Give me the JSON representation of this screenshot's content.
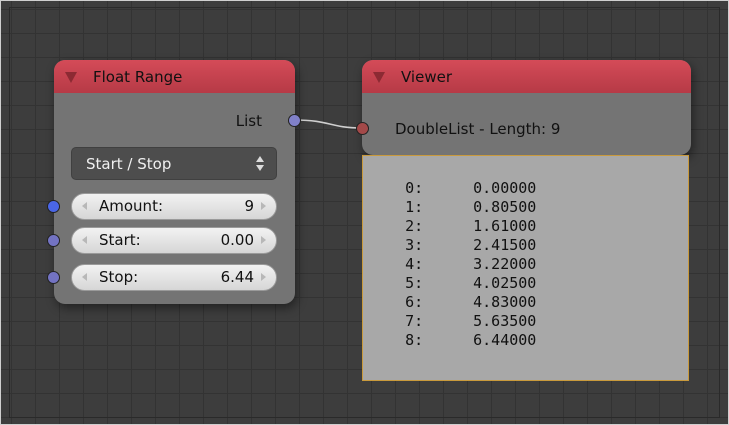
{
  "float_range_node": {
    "title": "Float Range",
    "output_label": "List",
    "mode_dropdown": {
      "selected": "Start / Stop"
    },
    "fields": [
      {
        "label": "Amount:",
        "value": "9",
        "socket_color": "#4a66e6"
      },
      {
        "label": "Start:",
        "value": "0.00",
        "socket_color": "#7373c2"
      },
      {
        "label": "Stop:",
        "value": "6.44",
        "socket_color": "#7373c2"
      }
    ],
    "output_socket_color": "#8080c8"
  },
  "viewer_node": {
    "title": "Viewer",
    "info_label": "DoubleList - Length: 9",
    "input_socket_color": "#a34949"
  },
  "text_panel": {
    "rows": [
      {
        "index": "0:",
        "value": "0.00000"
      },
      {
        "index": "1:",
        "value": "0.80500"
      },
      {
        "index": "2:",
        "value": "1.61000"
      },
      {
        "index": "3:",
        "value": "2.41500"
      },
      {
        "index": "4:",
        "value": "3.22000"
      },
      {
        "index": "5:",
        "value": "4.02500"
      },
      {
        "index": "6:",
        "value": "4.83000"
      },
      {
        "index": "7:",
        "value": "5.63500"
      },
      {
        "index": "8:",
        "value": "6.44000"
      }
    ]
  },
  "colors": {
    "header": "#c8404d",
    "node_body": "#747474",
    "canvas": "#3d3d3d",
    "panel_border": "#c99a3c"
  }
}
